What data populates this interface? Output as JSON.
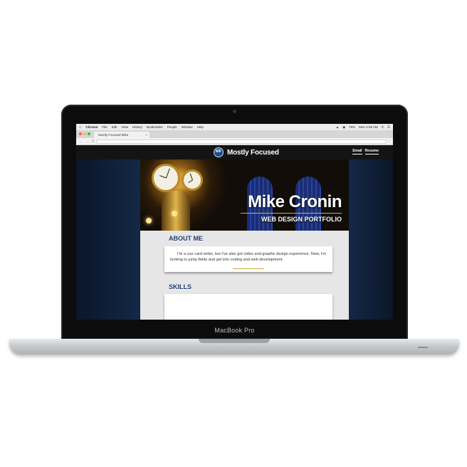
{
  "macos_menu": {
    "apple": "",
    "app": "Chrome",
    "items": [
      "File",
      "Edit",
      "View",
      "History",
      "Bookmarks",
      "People",
      "Window",
      "Help"
    ],
    "battery": "79%",
    "clock": "Mon 4:28 AM"
  },
  "browser": {
    "tab_title": "Mostly Focused Mike",
    "tab_close": "×",
    "back": "←",
    "forward": "→",
    "reload": "C",
    "menu": "⋮"
  },
  "site": {
    "logo_initials": "MF",
    "logo_text": "Mostly Focused",
    "nav": [
      "Email",
      "Resume"
    ],
    "hero_name": "Mike Cronin",
    "hero_subtitle": "WEB DESIGN PORTFOLIO",
    "about_title": "ABOUT ME",
    "about_text": "I'm a cue card writer, but I've also got video and graphic design experience. Now, I'm looking to jump fields and get into coding and web development.",
    "skills_title": "SKILLS"
  },
  "device": {
    "label": "MacBook Pro"
  },
  "colors": {
    "accent_gold": "#d9b13a",
    "heading_blue": "#1c3c6e",
    "page_bg": "#0d1a2e"
  }
}
